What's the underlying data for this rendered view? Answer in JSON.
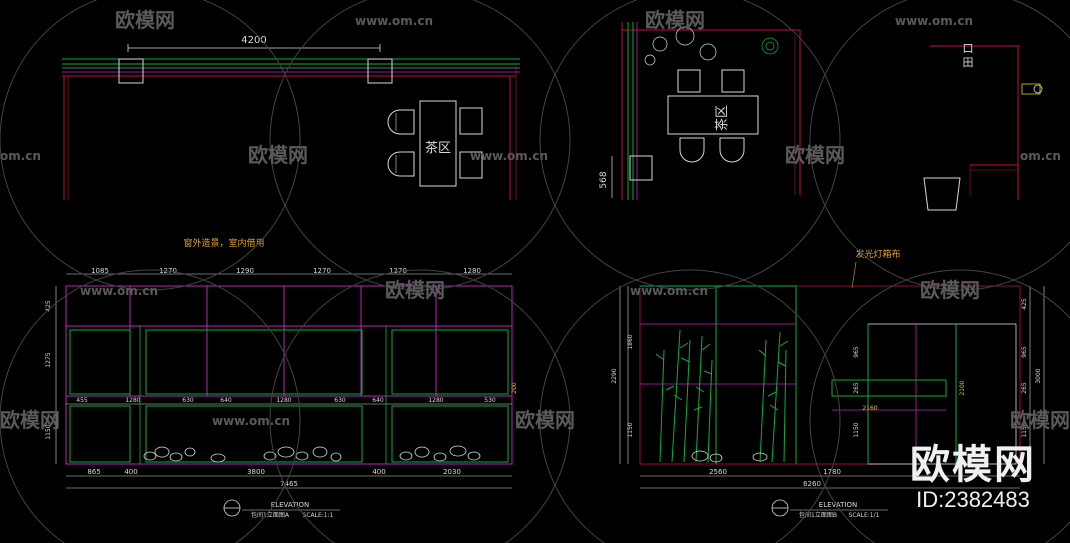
{
  "watermark": {
    "brand": "欧模网",
    "site": "www.om.cn",
    "site_short": "om.cn",
    "id_text": "ID:2382483"
  },
  "plan_left": {
    "dim_top": "4200",
    "tea_label": "茶区"
  },
  "plan_right": {
    "tea_label": "茶区",
    "dim_side": "568",
    "door_label": "口\n田"
  },
  "elev_a": {
    "note": "窗外造景，室内借用",
    "top_dims": [
      "1085",
      "1270",
      "1290",
      "1270",
      "1270",
      "1280"
    ],
    "mid_dims": [
      "455",
      "1280",
      "630",
      "640",
      "1280",
      "630",
      "640",
      "1280",
      "530"
    ],
    "bottom_dims": [
      "865",
      "400",
      "3800",
      "400",
      "2030"
    ],
    "total_dim": "7465",
    "left_dims": [
      "425",
      "1275",
      "1150"
    ],
    "side_dim": "200",
    "title_en": "ELEVATION",
    "title_cn": "包间1立面图A",
    "scale": "SCALE:1:1"
  },
  "elev_b": {
    "note": "发光灯箱布",
    "bottom_dims": [
      "2560",
      "1780"
    ],
    "total_dim": "6260",
    "left_dims": [
      "1860",
      "2290",
      "1150"
    ],
    "right_dims": [
      "425",
      "965",
      "265",
      "1150"
    ],
    "right_total": "3000",
    "inner_dims": [
      "965",
      "265",
      "1150",
      "2100"
    ],
    "inner_h": "2160",
    "title_en": "ELEVATION",
    "title_cn": "包间1立面图B",
    "scale": "SCALE:1/1"
  },
  "colors": {
    "background": "#000000",
    "red": "#c8102e",
    "green": "#00b43c",
    "magenta": "#c020c0",
    "white": "#d8d8d8",
    "yellow": "#e0d000",
    "orange": "#e8a020",
    "watermark": "#5a5a5a"
  }
}
